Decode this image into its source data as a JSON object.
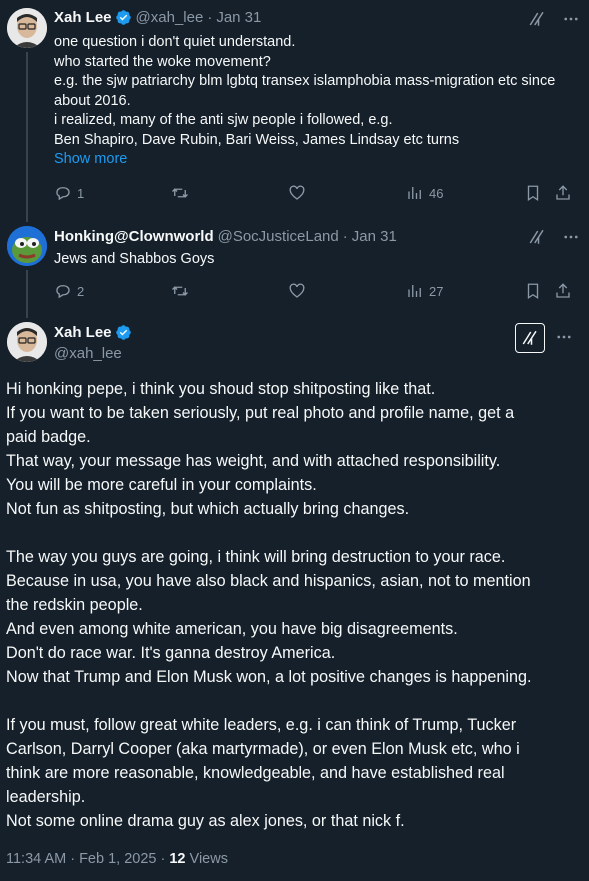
{
  "tweets": [
    {
      "name": "Xah Lee",
      "handle": "@xah_lee",
      "time": "Jan 31",
      "lines": [
        "one question i don't quiet understand.",
        "who started the woke movement?",
        "e.g. the sjw patriarchy blm lgbtq transex islamphobia mass-migration etc since",
        "about 2016.",
        "i realized, many of the anti sjw people i followed, e.g.",
        "Ben Shapiro, Dave Rubin, Bari Weiss, James Lindsay etc turns"
      ],
      "show_more": "Show more",
      "stats": {
        "replies": "1",
        "retweets": "",
        "likes": "",
        "views": "46"
      }
    },
    {
      "name": "Honking@Clownworld",
      "handle": "@SocJusticeLand",
      "time": "Jan 31",
      "lines": [
        "Jews and Shabbos Goys"
      ],
      "stats": {
        "replies": "2",
        "retweets": "",
        "likes": "",
        "views": "27"
      }
    }
  ],
  "focus": {
    "name": "Xah Lee",
    "handle": "@xah_lee",
    "paragraphs": [
      "Hi honking pepe, i think you shoud stop shitposting like that.",
      "If you want to be taken seriously, put real photo and profile name, get a",
      "paid badge.",
      "That way, your message has weight, and with attached responsibility.",
      "You will be more careful in your complaints.",
      "Not fun as shitposting, but which actually bring changes.",
      "",
      "The way you guys are going, i think will bring destruction to your race.",
      "Because in usa, you have also black and hispanics, asian, not to mention",
      "the redskin people.",
      "And even among white american, you have big disagreements.",
      "Don't do race war. It's ganna destroy America.",
      "Now that Trump and Elon Musk won, a lot positive changes is happening.",
      "",
      "If you must, follow great white leaders, e.g. i can think of Trump, Tucker",
      "Carlson, Darryl Cooper (aka martyrmade), or even Elon Musk etc, who i",
      "think are more reasonable, knowledgeable, and have established real",
      "leadership.",
      "Not some online drama guy as alex jones, or that nick f."
    ],
    "timestamp": "11:34 AM · Feb 1, 2025 · ",
    "views_count": "12",
    "views_label": " Views"
  },
  "icons": {
    "reply": "reply-icon",
    "retweet": "retweet-icon",
    "like": "heart-icon",
    "views": "views-icon",
    "bookmark": "bookmark-icon",
    "share": "share-icon",
    "grok": "grok-icon",
    "more": "more-icon",
    "verified": "verified-badge-icon"
  },
  "colors": {
    "background": "#15202b",
    "text": "#f7f9f9",
    "muted": "#8b98a5",
    "accent": "#1d9bf0"
  }
}
